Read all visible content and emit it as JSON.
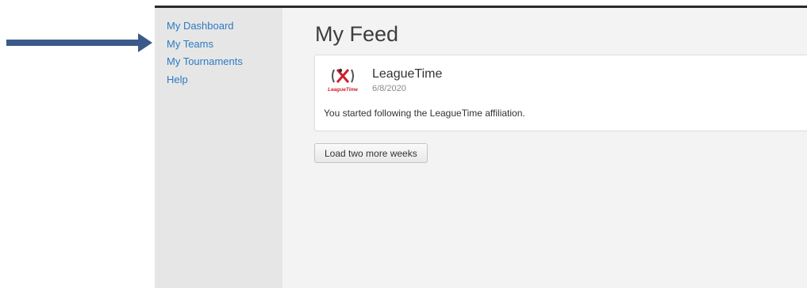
{
  "sidebar": {
    "items": [
      {
        "label": "My Dashboard"
      },
      {
        "label": "My Teams"
      },
      {
        "label": "My Tournaments"
      },
      {
        "label": "Help"
      }
    ]
  },
  "main": {
    "title": "My Feed",
    "feed": [
      {
        "logo": "leaguetime-logo",
        "logo_text": "LeagueTime",
        "name": "LeagueTime",
        "date": "6/8/2020",
        "message": "You started following the LeagueTime affiliation."
      }
    ],
    "load_more_label": "Load two more weeks"
  },
  "annotation": {
    "arrow_icon": "arrow-right-icon",
    "arrow_color": "#3a5a8a"
  },
  "colors": {
    "link": "#2b7bc4",
    "sidebar_bg": "#e6e6e6",
    "main_bg": "#f3f3f3",
    "logo_red": "#d0202a"
  }
}
